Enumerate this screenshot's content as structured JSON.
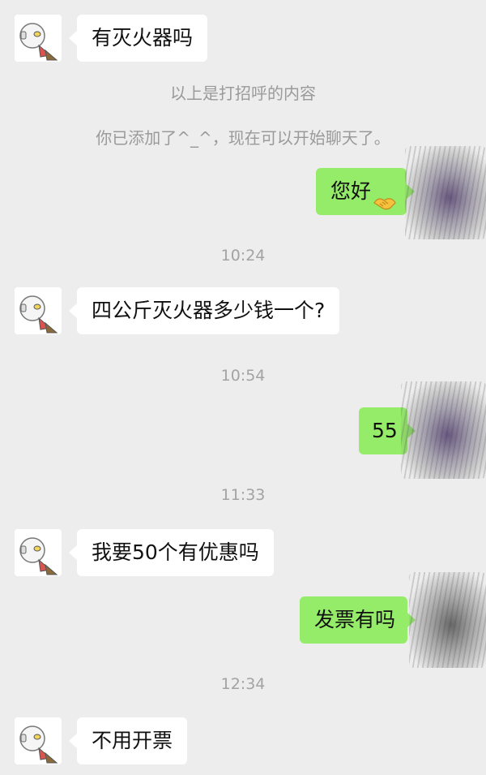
{
  "messages": [
    {
      "side": "left",
      "text": "有灭火器吗"
    },
    {
      "side": "right",
      "text": "您好",
      "emoji": "handshake-icon"
    },
    {
      "side": "left",
      "text": "四公斤灭火器多少钱一个?"
    },
    {
      "side": "right",
      "text": "55"
    },
    {
      "side": "left",
      "text": "我要50个有优惠吗"
    },
    {
      "side": "right",
      "text": "发票有吗"
    },
    {
      "side": "left",
      "text": "不用开票"
    }
  ],
  "system": {
    "greeting_note": "以上是打招呼的内容",
    "added_note": "你已添加了^_^，现在可以开始聊天了。"
  },
  "times": [
    "10:24",
    "10:54",
    "11:33",
    "12:34"
  ],
  "colors": {
    "background": "#ededed",
    "self_bubble": "#95ec69",
    "other_bubble": "#ffffff",
    "system_text": "#9a9a9a"
  }
}
